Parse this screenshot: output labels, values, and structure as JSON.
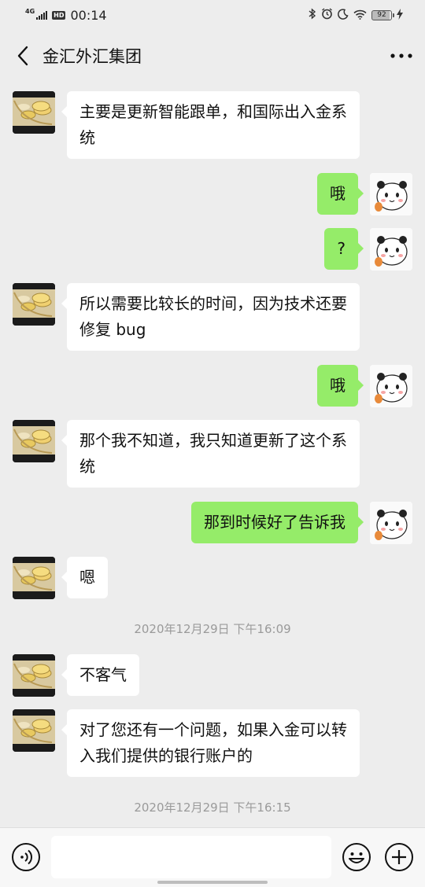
{
  "status_bar": {
    "network": "4G",
    "hd": "HD",
    "time": "00:14",
    "battery": "92",
    "icons": [
      "bluetooth-icon",
      "alarm-icon",
      "moon-icon",
      "wifi-icon",
      "battery-icon",
      "charging-icon"
    ]
  },
  "header": {
    "title": "金汇外汇集团",
    "back_icon": "chevron-left-icon",
    "more_icon": "more-dots-icon"
  },
  "messages": [
    {
      "side": "left",
      "text": "主要是更新智能跟单，和国际出入金系统"
    },
    {
      "side": "right",
      "text": "哦"
    },
    {
      "side": "right",
      "text": "?"
    },
    {
      "side": "left",
      "text": "所以需要比较长的时间，因为技术还要修复 bug"
    },
    {
      "side": "right",
      "text": "哦"
    },
    {
      "side": "left",
      "text": "那个我不知道，我只知道更新了这个系统"
    },
    {
      "side": "right",
      "text": "那到时候好了告诉我"
    },
    {
      "side": "left",
      "text": "嗯"
    },
    {
      "side": "left",
      "text": "不客气"
    },
    {
      "side": "left",
      "text": "对了您还有一个问题，如果入金可以转入我们提供的银行账户的"
    }
  ],
  "timestamps": [
    "2020年12月29日 下午16:09",
    "2020年12月29日 下午16:15"
  ],
  "input_bar": {
    "voice_icon": "voice-icon",
    "text_value": "",
    "emoji_icon": "emoji-icon",
    "plus_icon": "plus-icon"
  },
  "colors": {
    "background": "#ededed",
    "self_bubble": "#95ec69",
    "other_bubble": "#ffffff",
    "timestamp_text": "#9a9a9a"
  }
}
